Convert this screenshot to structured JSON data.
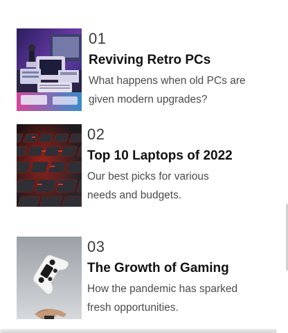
{
  "articles": [
    {
      "number": "01",
      "title": "Reviving Retro PCs",
      "description": "What happens when old PCs are given modern upgrades?",
      "image_subject": "retro computers under neon lights"
    },
    {
      "number": "02",
      "title": "Top 10 Laptops of 2022",
      "description": "Our best picks for various needs and budgets.",
      "image_subject": "laptop keyboard with red backlight"
    },
    {
      "number": "03",
      "title": "The Growth of Gaming",
      "description": "How the pandemic has sparked fresh opportunities.",
      "image_subject": "game controller floating above a hand"
    }
  ]
}
